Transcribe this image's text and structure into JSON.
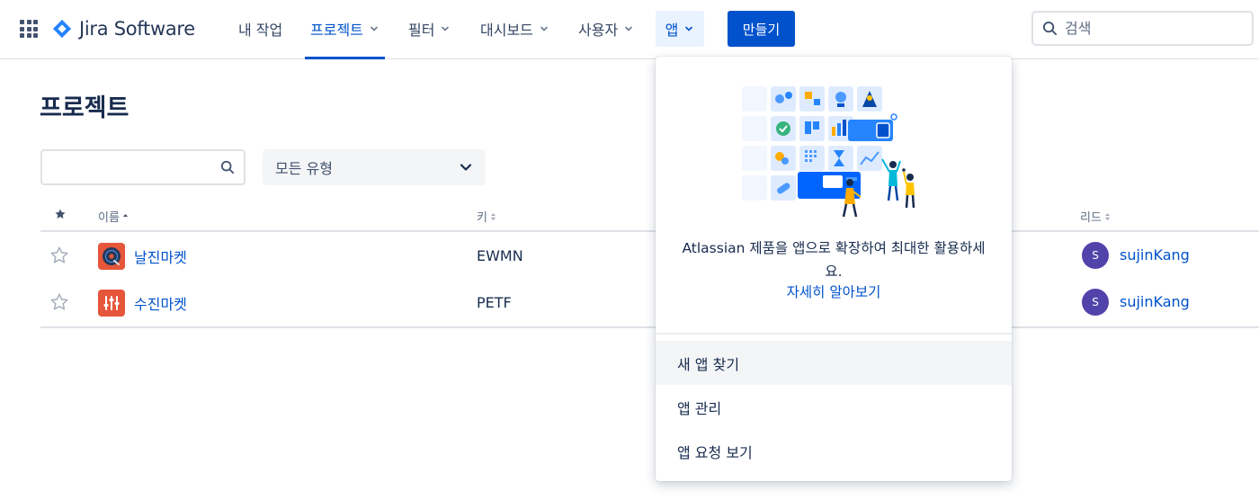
{
  "app": {
    "name": "Jira Software"
  },
  "nav": {
    "items": [
      {
        "label": "내 작업",
        "has_chevron": false
      },
      {
        "label": "프로젝트",
        "has_chevron": true
      },
      {
        "label": "필터",
        "has_chevron": true
      },
      {
        "label": "대시보드",
        "has_chevron": true
      },
      {
        "label": "사용자",
        "has_chevron": true
      },
      {
        "label": "앱",
        "has_chevron": true
      }
    ],
    "active_item": "프로젝트",
    "open_item": "앱",
    "create_label": "만들기",
    "search_placeholder": "검색"
  },
  "page": {
    "title": "프로젝트",
    "filter_input_value": "",
    "type_select": "모든 유형"
  },
  "table": {
    "headers": {
      "name": "이름",
      "key": "키",
      "lead": "리드"
    },
    "rows": [
      {
        "name": "날진마켓",
        "key": "EWMN",
        "lead_initial": "S",
        "lead": "sujinKang",
        "starred": false
      },
      {
        "name": "수진마켓",
        "key": "PETF",
        "lead_initial": "S",
        "lead": "sujinKang",
        "starred": false
      }
    ]
  },
  "apps_dropdown": {
    "promo_text": "Atlassian 제품을 앱으로 확장하여 최대한 활용하세요.",
    "learn_more": "자세히 알아보기",
    "items": [
      "새 앱 찾기",
      "앱 관리",
      "앱 요청 보기"
    ],
    "hovered_item": "새 앱 찾기"
  },
  "colors": {
    "brand_blue": "#0052CC",
    "text_dark": "#172B4D",
    "project_avatar": "#E5563A",
    "lead_avatar": "#5243AA"
  }
}
